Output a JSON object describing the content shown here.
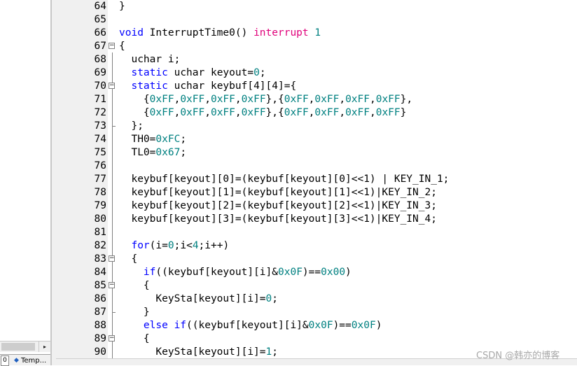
{
  "left_panel": {
    "tabs": {
      "books_label": "0",
      "templates_label": "Temp..."
    },
    "scroll_right_arrow": "▸"
  },
  "editor": {
    "lines": [
      {
        "n": "64",
        "fold": "",
        "tokens": [
          [
            "txt",
            "}"
          ]
        ]
      },
      {
        "n": "65",
        "fold": "",
        "tokens": []
      },
      {
        "n": "66",
        "fold": "",
        "tokens": [
          [
            "kw",
            "void"
          ],
          [
            "txt",
            " InterruptTime0() "
          ],
          [
            "kw2",
            "interrupt"
          ],
          [
            "txt",
            " "
          ],
          [
            "num",
            "1"
          ]
        ]
      },
      {
        "n": "67",
        "fold": "-",
        "tokens": [
          [
            "txt",
            "{"
          ]
        ]
      },
      {
        "n": "68",
        "fold": "",
        "tokens": [
          [
            "txt",
            "  uchar i;"
          ]
        ]
      },
      {
        "n": "69",
        "fold": "",
        "tokens": [
          [
            "txt",
            "  "
          ],
          [
            "kw",
            "static"
          ],
          [
            "txt",
            " uchar keyout="
          ],
          [
            "num",
            "0"
          ],
          [
            "txt",
            ";"
          ]
        ]
      },
      {
        "n": "70",
        "fold": "-",
        "tokens": [
          [
            "txt",
            "  "
          ],
          [
            "kw",
            "static"
          ],
          [
            "txt",
            " uchar keybuf[4][4]={"
          ]
        ]
      },
      {
        "n": "71",
        "fold": "",
        "tokens": [
          [
            "txt",
            "    {"
          ],
          [
            "num",
            "0xFF"
          ],
          [
            "txt",
            ","
          ],
          [
            "num",
            "0xFF"
          ],
          [
            "txt",
            ","
          ],
          [
            "num",
            "0xFF"
          ],
          [
            "txt",
            ","
          ],
          [
            "num",
            "0xFF"
          ],
          [
            "txt",
            "},{"
          ],
          [
            "num",
            "0xFF"
          ],
          [
            "txt",
            ","
          ],
          [
            "num",
            "0xFF"
          ],
          [
            "txt",
            ","
          ],
          [
            "num",
            "0xFF"
          ],
          [
            "txt",
            ","
          ],
          [
            "num",
            "0xFF"
          ],
          [
            "txt",
            "},"
          ]
        ]
      },
      {
        "n": "72",
        "fold": "",
        "tokens": [
          [
            "txt",
            "    {"
          ],
          [
            "num",
            "0xFF"
          ],
          [
            "txt",
            ","
          ],
          [
            "num",
            "0xFF"
          ],
          [
            "txt",
            ","
          ],
          [
            "num",
            "0xFF"
          ],
          [
            "txt",
            ","
          ],
          [
            "num",
            "0xFF"
          ],
          [
            "txt",
            "},{"
          ],
          [
            "num",
            "0xFF"
          ],
          [
            "txt",
            ","
          ],
          [
            "num",
            "0xFF"
          ],
          [
            "txt",
            ","
          ],
          [
            "num",
            "0xFF"
          ],
          [
            "txt",
            ","
          ],
          [
            "num",
            "0xFF"
          ],
          [
            "txt",
            "}"
          ]
        ]
      },
      {
        "n": "73",
        "fold": "end",
        "tokens": [
          [
            "txt",
            "  };"
          ]
        ]
      },
      {
        "n": "74",
        "fold": "",
        "tokens": [
          [
            "txt",
            "  TH0="
          ],
          [
            "num",
            "0xFC"
          ],
          [
            "txt",
            ";"
          ]
        ]
      },
      {
        "n": "75",
        "fold": "",
        "tokens": [
          [
            "txt",
            "  TL0="
          ],
          [
            "num",
            "0x67"
          ],
          [
            "txt",
            ";"
          ]
        ]
      },
      {
        "n": "76",
        "fold": "",
        "tokens": []
      },
      {
        "n": "77",
        "fold": "",
        "tokens": [
          [
            "txt",
            "  keybuf[keyout][0]=(keybuf[keyout][0]<<1) | KEY_IN_1;"
          ]
        ]
      },
      {
        "n": "78",
        "fold": "",
        "tokens": [
          [
            "txt",
            "  keybuf[keyout][1]=(keybuf[keyout][1]<<1)|KEY_IN_2;"
          ]
        ]
      },
      {
        "n": "79",
        "fold": "",
        "tokens": [
          [
            "txt",
            "  keybuf[keyout][2]=(keybuf[keyout][2]<<1)|KEY_IN_3;"
          ]
        ]
      },
      {
        "n": "80",
        "fold": "",
        "tokens": [
          [
            "txt",
            "  keybuf[keyout][3]=(keybuf[keyout][3]<<1)|KEY_IN_4;"
          ]
        ]
      },
      {
        "n": "81",
        "fold": "",
        "tokens": []
      },
      {
        "n": "82",
        "fold": "",
        "tokens": [
          [
            "txt",
            "  "
          ],
          [
            "kw",
            "for"
          ],
          [
            "txt",
            "(i="
          ],
          [
            "num",
            "0"
          ],
          [
            "txt",
            ";i<"
          ],
          [
            "num",
            "4"
          ],
          [
            "txt",
            ";i++)"
          ]
        ]
      },
      {
        "n": "83",
        "fold": "-",
        "tokens": [
          [
            "txt",
            "  {"
          ]
        ]
      },
      {
        "n": "84",
        "fold": "",
        "tokens": [
          [
            "txt",
            "    "
          ],
          [
            "kw",
            "if"
          ],
          [
            "txt",
            "((keybuf[keyout][i]&"
          ],
          [
            "num",
            "0x0F"
          ],
          [
            "txt",
            ")=="
          ],
          [
            "num",
            "0x00"
          ],
          [
            "txt",
            ")"
          ]
        ]
      },
      {
        "n": "85",
        "fold": "-",
        "tokens": [
          [
            "txt",
            "    {"
          ]
        ]
      },
      {
        "n": "86",
        "fold": "",
        "tokens": [
          [
            "txt",
            "      KeySta[keyout][i]="
          ],
          [
            "num",
            "0"
          ],
          [
            "txt",
            ";"
          ]
        ]
      },
      {
        "n": "87",
        "fold": "end",
        "tokens": [
          [
            "txt",
            "    }"
          ]
        ]
      },
      {
        "n": "88",
        "fold": "",
        "tokens": [
          [
            "txt",
            "    "
          ],
          [
            "kw",
            "else"
          ],
          [
            "txt",
            " "
          ],
          [
            "kw",
            "if"
          ],
          [
            "txt",
            "((keybuf[keyout][i]&"
          ],
          [
            "num",
            "0x0F"
          ],
          [
            "txt",
            ")=="
          ],
          [
            "num",
            "0x0F"
          ],
          [
            "txt",
            ")"
          ]
        ]
      },
      {
        "n": "89",
        "fold": "-",
        "tokens": [
          [
            "txt",
            "    {"
          ]
        ]
      },
      {
        "n": "90",
        "fold": "",
        "tokens": [
          [
            "txt",
            "      KeySta[keyout][i]="
          ],
          [
            "num",
            "1"
          ],
          [
            "txt",
            ";"
          ]
        ]
      }
    ]
  },
  "watermark": "CSDN @韩亦的博客",
  "colors": {
    "keyword": "#0000ff",
    "keyword_extension": "#e0007a",
    "number": "#008080",
    "text": "#000000",
    "gutter_bg": "#f0f0f0"
  }
}
